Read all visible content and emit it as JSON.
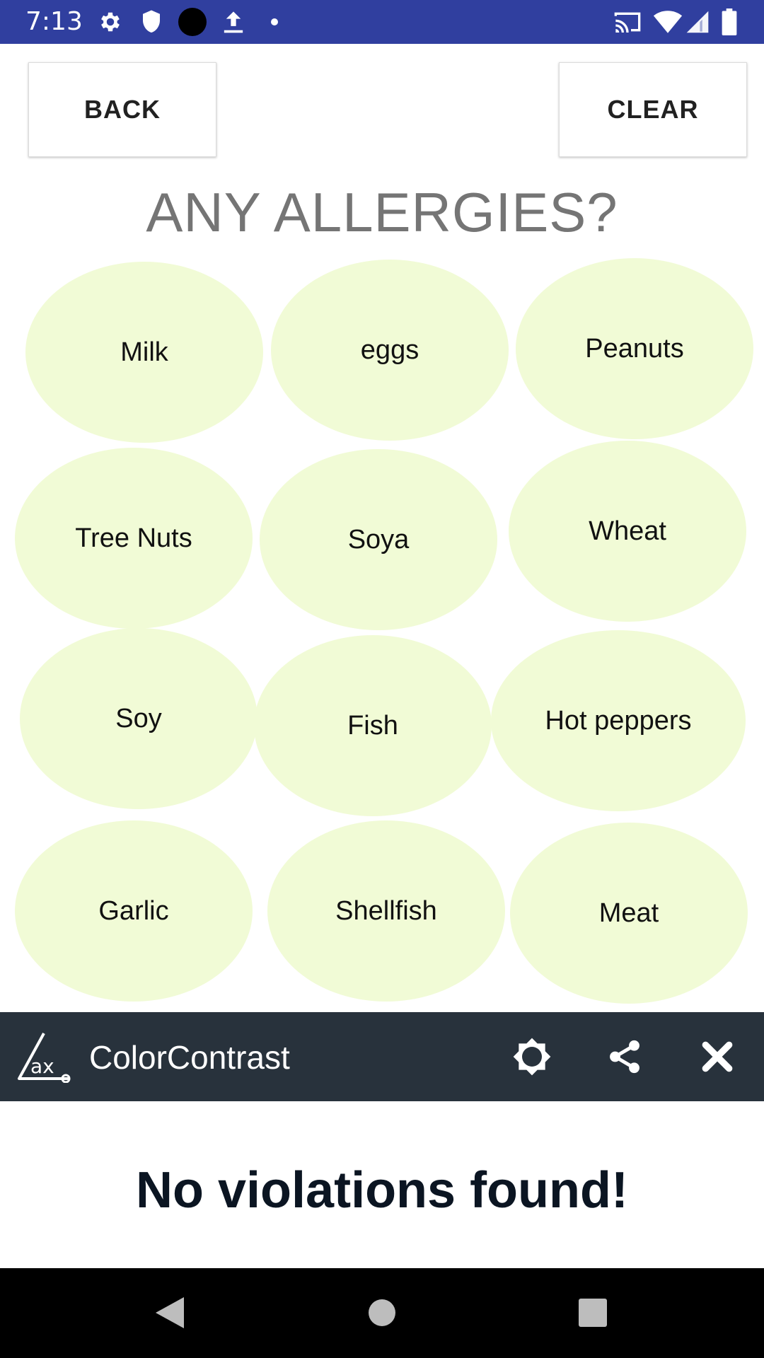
{
  "status_bar": {
    "time": "7:13",
    "bg_color": "#303f9f",
    "left_icons": [
      "settings-icon",
      "shield-icon",
      "dot-icon",
      "upload-icon",
      "small-dot-icon"
    ],
    "right_icons": [
      "cast-icon",
      "wifi-icon",
      "signal-icon",
      "battery-icon"
    ]
  },
  "header": {
    "back_label": "BACK",
    "clear_label": "CLEAR",
    "title": "ANY ALLERGIES?"
  },
  "allergens": [
    {
      "label": "Milk"
    },
    {
      "label": "eggs"
    },
    {
      "label": "Peanuts"
    },
    {
      "label": "Tree Nuts"
    },
    {
      "label": "Soya"
    },
    {
      "label": "Wheat"
    },
    {
      "label": "Soy"
    },
    {
      "label": "Fish"
    },
    {
      "label": "Hot peppers"
    },
    {
      "label": "Garlic"
    },
    {
      "label": "Shellfish"
    },
    {
      "label": "Meat"
    }
  ],
  "oval_color": "#f1fbd6",
  "ax_toolbar": {
    "logo_icon": "ax-logo-icon",
    "name": "ColorContrast",
    "icons": [
      "brightness-icon",
      "share-icon",
      "close-icon"
    ],
    "bg_color": "#28323c"
  },
  "result": {
    "message": "No violations found!"
  },
  "nav_bar": {
    "icons": [
      "back-triangle-icon",
      "home-circle-icon",
      "recents-square-icon"
    ]
  }
}
